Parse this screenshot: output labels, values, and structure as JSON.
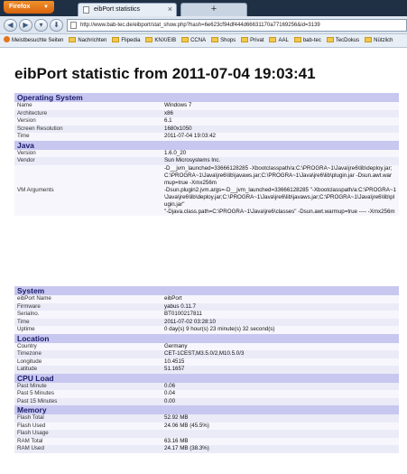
{
  "browser": {
    "app_button": "Firefox",
    "tab_title": "eibPort statistics",
    "new_tab": "+",
    "url": "http://www.bab-tec.de/eibport/stat_show.php?hash=6e623cf94df444d66631170a77169256&id=3139",
    "bookmarks": [
      "Meistbesuchte Seiten",
      "Nachrichten",
      "Flipedia",
      "KNX/EIB",
      "CCNA",
      "Shops",
      "Privat",
      "AAL",
      "bab-tec",
      "TecDokus",
      "Nützlich"
    ]
  },
  "page": {
    "title": "eibPort statistic from 2011-07-04 19:03:41"
  },
  "table1": [
    {
      "section": "Operating System"
    },
    {
      "label": "Name",
      "value": "Windows 7"
    },
    {
      "label": "Architecture",
      "value": "x86"
    },
    {
      "label": "Version",
      "value": "6.1"
    },
    {
      "label": "Screen Resolution",
      "value": "1680x1050"
    },
    {
      "label": "Time",
      "value": "2011-07-04 19:03:42"
    },
    {
      "section": "Java"
    },
    {
      "label": "Version",
      "value": "1.6.0_20"
    },
    {
      "label": "Vendor",
      "value": "Sun Microsystems Inc."
    },
    {
      "label": "VM Arguments",
      "value": "-D__jvm_launched=33666128285 -Xbootclasspath/a:C:\\PROGRA~1\\Java\\jre6\\lib\\deploy.jar;C:\\PROGRA~1\\Java\\jre6\\lib\\javaws.jar;C:\\PROGRA~1\\Java\\jre6\\lib\\plugin.jar -Dsun.awt.warmup=true -Xmx256m\n-Dsun.plugin2.jvm.args=-D__jvm_launched=33666128285 \"-Xbootclasspath/a:C:\\PROGRA~1\\Java\\jre6\\lib\\deploy.jar;C:\\PROGRA~1\\Java\\jre6\\lib\\javaws.jar;C:\\PROGRA~1\\Java\\jre6\\lib\\plugin.jar\"\n\"-Djava.class.path=C:\\PROGRA~1\\Java\\jre6\\classes\" -Dsun.awt.warmup=true ---- -Xmx256m",
      "multiline": true
    }
  ],
  "table2": [
    {
      "section": "System"
    },
    {
      "label": "eibPort Name",
      "value": "eibPort"
    },
    {
      "label": "Firmware",
      "value": "yabus 0.11.7"
    },
    {
      "label": "Serialno.",
      "value": "BT0100217811"
    },
    {
      "label": "Time",
      "value": "2011-07-02 03:28:10"
    },
    {
      "label": "Uptime",
      "value": "0 day(s) 9 hour(s) 23 minute(s) 32 second(s)"
    },
    {
      "section": "Location"
    },
    {
      "label": "Country",
      "value": "Germany"
    },
    {
      "label": "Timezone",
      "value": "CET-1CEST,M3.5.0/2,M10.5.0/3"
    },
    {
      "label": "Longitude",
      "value": "10.4515"
    },
    {
      "label": "Latitude",
      "value": "51.1657"
    },
    {
      "section": "CPU Load"
    },
    {
      "label": "Past Minute",
      "value": "0.06"
    },
    {
      "label": "Past 5 Minutes",
      "value": "0.04"
    },
    {
      "label": "Past 15 Minutes",
      "value": "0.00"
    },
    {
      "section": "Memory"
    },
    {
      "label": "Flash Total",
      "value": "52.92 MB"
    },
    {
      "label": "Flash Used",
      "value": "24.06 MB (45.5%)"
    },
    {
      "label": "Flash Usage",
      "value": ""
    },
    {
      "label": "RAM Total",
      "value": "63.16 MB"
    },
    {
      "label": "RAM Used",
      "value": "24.17 MB (38.3%)"
    }
  ]
}
